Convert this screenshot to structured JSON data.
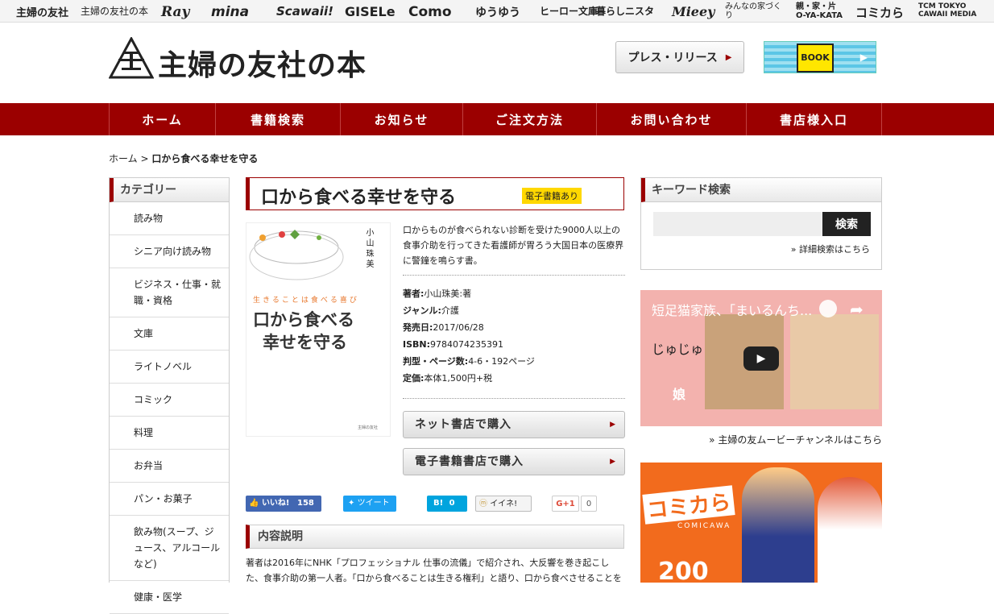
{
  "brands": [
    "主婦の友社",
    "主婦の友社の本",
    "Ray",
    "mina",
    "Scawaii!",
    "GISELe",
    "Como",
    "ゆうゆう",
    "ヒーロー文庫",
    "暮らしニスタ",
    "Mieey",
    "みんなの家づくり",
    "親・家・片 O-YA-KATA",
    "コミカら",
    "TCM TOKYO CAWAII MEDIA"
  ],
  "header": {
    "logo_text": "主婦の友社の本",
    "press_label": "プレス・リリース",
    "banner_label": "BOOK"
  },
  "nav": [
    "ホーム",
    "書籍検索",
    "お知らせ",
    "ご注文方法",
    "お問い合わせ",
    "書店様入口"
  ],
  "breadcrumb": {
    "home": "ホーム",
    "sep": ">",
    "current": "口から食べる幸せを守る"
  },
  "sidebar": {
    "heading": "カテゴリー",
    "items": [
      "読み物",
      "シニア向け読み物",
      "ビジネス・仕事・就職・資格",
      "文庫",
      "ライトノベル",
      "コミック",
      "料理",
      "お弁当",
      "パン・お菓子",
      "飲み物(スープ、ジュース、アルコールなど)",
      "健康・医学"
    ]
  },
  "book": {
    "title": "口から食べる幸せを守る",
    "ebook_badge": "電子書籍あり",
    "cover": {
      "subtitle": "生きることは食べる喜び",
      "title_line1": "口から食べる",
      "title_line2": "幸せを守る",
      "author": "小山珠美",
      "publisher": "主婦の友社"
    },
    "description": "口からものが食べられない診断を受けた9000人以上の食事介助を行ってきた看護師が胃ろう大国日本の医療界に警鐘を鳴らす書。",
    "info": [
      {
        "label": "著者:",
        "value": "小山珠美:著"
      },
      {
        "label": "ジャンル:",
        "value": "介護"
      },
      {
        "label": "発売日:",
        "value": "2017/06/28"
      },
      {
        "label": "ISBN:",
        "value": "9784074235391"
      },
      {
        "label": "判型・ページ数:",
        "value": "4-6・192ページ"
      },
      {
        "label": "定価:",
        "value": "本体1,500円+税"
      }
    ],
    "buy_net": "ネット書店で購入",
    "buy_ebook": "電子書籍書店で購入"
  },
  "social": {
    "fb_label": "いいね!",
    "fb_count": "158",
    "tw_label": "ツイート",
    "hb_label": "B!",
    "hb_count": "0",
    "mixi_label": "イイネ!",
    "gplus_label": "G+1",
    "gplus_count": "0"
  },
  "section": {
    "heading": "内容説明",
    "text": "著者は2016年にNHK「プロフェッショナル 仕事の流儀」で紹介され、大反響を巻き起こした、食事介助の第一人者。「口から食べることは生きる権利」と語り、口から食べさせることを"
  },
  "right": {
    "kw_heading": "キーワード検索",
    "kw_button": "検索",
    "kw_placeholder": "",
    "kw_advanced": "詳細検索はこちら",
    "video_title": "短足猫家族、「まいるんち...",
    "video_caption": "娘",
    "video_text": "じゅじゅ",
    "video_link": "主婦の友ムービーチャンネルはこちら",
    "comi_logo": "コミカら",
    "comi_sub": "COMICAWA",
    "comi_num": "200"
  }
}
